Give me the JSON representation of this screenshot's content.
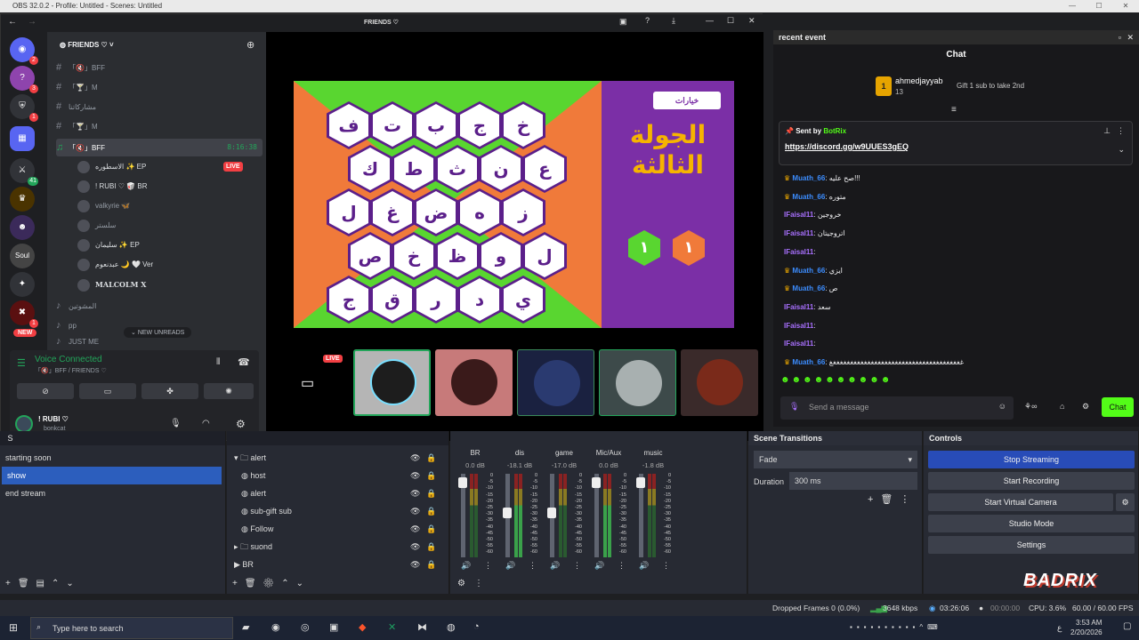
{
  "obs": {
    "title": "OBS 32.0.2 - Profile: Untitled - Scenes: Untitled"
  },
  "discord": {
    "window_title": "FRIENDS ♡",
    "server_name": "FRIENDS ♡",
    "badges": {
      "s1": "2",
      "s2": "3",
      "s3": "1",
      "s4": "41",
      "s5": "1"
    },
    "channels": [
      {
        "name": "「🔇」BFF"
      },
      {
        "name": "「🍸」M"
      },
      {
        "name": "مشاركاتنا"
      },
      {
        "name": "「🍸」M"
      }
    ],
    "active_voice": {
      "name": "「🔇」BFF",
      "timer": "8:16:38"
    },
    "voice_users": [
      {
        "name": "الاسطوره ✨ EP",
        "tag": "LIVE"
      },
      {
        "name": "! RUBI ♡ 🥡 BR"
      },
      {
        "name": "valkyrie 🦋"
      },
      {
        "name": "سلستر"
      },
      {
        "name": "سليمان ✨ EP"
      },
      {
        "name": "عبدنعوم 🌙 🤍 Ver"
      },
      {
        "name": "MALCOLM X"
      }
    ],
    "more_channels": [
      {
        "name": "المشوتين"
      },
      {
        "name": "pp"
      },
      {
        "name": "JUST ME"
      }
    ],
    "new_label": "NEW",
    "new_unreads": "NEW UNREADS",
    "voice_connected": "Voice Connected",
    "voice_path": "「🔇」BFF / FRIENDS ♡",
    "user": {
      "name": "! RUBI ♡",
      "status": "bonkcat"
    },
    "live_badge": "LIVE",
    "game": {
      "button": "خيارات",
      "title1": "الجولة",
      "title2": "الثالثة",
      "score_green": "١",
      "score_orange": "١",
      "letters": [
        "ف",
        "ت",
        "ب",
        "ج",
        "خ",
        "ك",
        "ط",
        "ث",
        "ن",
        "ع",
        "ل",
        "غ",
        "ض",
        "ه",
        "ز",
        "ص",
        "خ",
        "ظ",
        "و",
        "ل",
        "ج",
        "ق",
        "ر",
        "د",
        "ي"
      ]
    }
  },
  "chat": {
    "dock_title": "recent event",
    "title": "Chat",
    "gift_user": "ahmedjayyab",
    "gift_count": "13",
    "gift_text": "Gift 1 sub to take 2nd",
    "pinned_by": "Sent by",
    "pinned_author": "BotRix",
    "pinned_link": "https://discord.gg/w9UUES3gEQ",
    "messages": [
      {
        "user": "Muath_66",
        "text": "صح عليه!!!"
      },
      {
        "user": "Muath_66",
        "text": "متوره"
      },
      {
        "user": "lFaisal11",
        "text": "خروجين"
      },
      {
        "user": "lFaisal11",
        "text": "اتروجيتان"
      },
      {
        "user": "lFaisal11",
        "text": ""
      },
      {
        "user": "Muath_66",
        "text": "ايزي"
      },
      {
        "user": "Muath_66",
        "text": "ص"
      },
      {
        "user": "lFaisal11",
        "text": "سعد"
      },
      {
        "user": "lFaisal11",
        "text": ""
      },
      {
        "user": "lFaisal11",
        "text": ""
      },
      {
        "user": "Muath_66",
        "text": "غغغغغغغغغغغغغغغغغغغغغغغغغغغغغغغغغغغغغغغ"
      }
    ],
    "input_placeholder": "Send a message",
    "chat_button": "Chat"
  },
  "scenes": {
    "items": [
      "starting soon",
      "show",
      "end stream"
    ],
    "selected": 1
  },
  "sources": {
    "items": [
      {
        "name": "alert",
        "folder": true
      },
      {
        "name": "host"
      },
      {
        "name": "alert"
      },
      {
        "name": "sub-gift sub"
      },
      {
        "name": "Follow"
      },
      {
        "name": "suond",
        "folder": true
      },
      {
        "name": "BR",
        "group": true
      }
    ]
  },
  "mixer": {
    "channels": [
      {
        "name": "BR",
        "db": "0.0 dB"
      },
      {
        "name": "dis",
        "db": "-18.1 dB"
      },
      {
        "name": "game",
        "db": "-17.0 dB"
      },
      {
        "name": "Mic/Aux",
        "db": "0.0 dB"
      },
      {
        "name": "music",
        "db": "-1.8 dB"
      }
    ],
    "ticks": [
      "0",
      "-5",
      "-10",
      "-15",
      "-20",
      "-25",
      "-30",
      "-35",
      "-40",
      "-45",
      "-50",
      "-55",
      "-60"
    ]
  },
  "transitions": {
    "title": "Scene Transitions",
    "type": "Fade",
    "duration_label": "Duration",
    "duration": "300 ms"
  },
  "controls": {
    "title": "Controls",
    "buttons": [
      "Stop Streaming",
      "Start Recording",
      "Start Virtual Camera",
      "Studio Mode",
      "Settings"
    ]
  },
  "status": {
    "dropped": "Dropped Frames 0 (0.0%)",
    "kbps": "3648 kbps",
    "stream_time": "03:26:06",
    "rec_time": "00:00:00",
    "cpu": "CPU: 3.6%",
    "fps": "60.00 / 60.00 FPS"
  },
  "taskbar": {
    "search": "Type here to search",
    "time": "3:53 AM",
    "date": "2/20/2026",
    "lang": "ع"
  },
  "logo": "BADRIX"
}
